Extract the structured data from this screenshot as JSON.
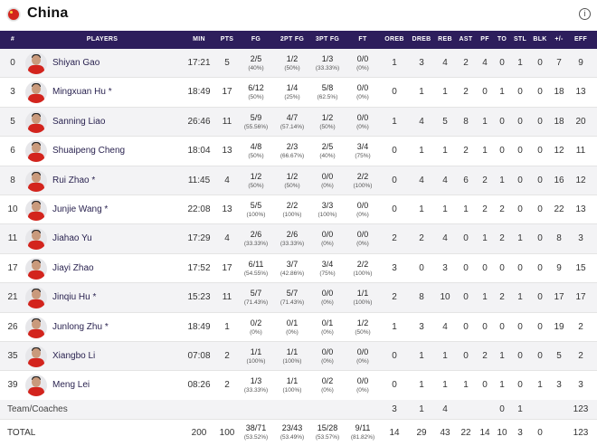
{
  "team": {
    "name": "China",
    "flag_icon": "china-flag-icon",
    "info_icon": "info-icon",
    "info_glyph": "i"
  },
  "columns": [
    "#",
    "PLAYERS",
    "MIN",
    "PTS",
    "FG",
    "2PT FG",
    "3PT FG",
    "FT",
    "OREB",
    "DREB",
    "REB",
    "AST",
    "PF",
    "TO",
    "STL",
    "BLK",
    "+/-",
    "EFF"
  ],
  "players": [
    {
      "num": "0",
      "name": "Shiyan Gao",
      "min": "17:21",
      "pts": "5",
      "fg": "2/5",
      "fg_p": "(40%)",
      "tp": "1/2",
      "tp_p": "(50%)",
      "thr": "1/3",
      "thr_p": "(33.33%)",
      "ft": "0/0",
      "ft_p": "(0%)",
      "oreb": "1",
      "dreb": "3",
      "reb": "4",
      "ast": "2",
      "pf": "4",
      "to": "0",
      "stl": "1",
      "blk": "0",
      "pm": "7",
      "eff": "9"
    },
    {
      "num": "3",
      "name": "Mingxuan Hu *",
      "min": "18:49",
      "pts": "17",
      "fg": "6/12",
      "fg_p": "(50%)",
      "tp": "1/4",
      "tp_p": "(25%)",
      "thr": "5/8",
      "thr_p": "(62.5%)",
      "ft": "0/0",
      "ft_p": "(0%)",
      "oreb": "0",
      "dreb": "1",
      "reb": "1",
      "ast": "2",
      "pf": "0",
      "to": "1",
      "stl": "0",
      "blk": "0",
      "pm": "18",
      "eff": "13"
    },
    {
      "num": "5",
      "name": "Sanning Liao",
      "min": "26:46",
      "pts": "11",
      "fg": "5/9",
      "fg_p": "(55.56%)",
      "tp": "4/7",
      "tp_p": "(57.14%)",
      "thr": "1/2",
      "thr_p": "(50%)",
      "ft": "0/0",
      "ft_p": "(0%)",
      "oreb": "1",
      "dreb": "4",
      "reb": "5",
      "ast": "8",
      "pf": "1",
      "to": "0",
      "stl": "0",
      "blk": "0",
      "pm": "18",
      "eff": "20"
    },
    {
      "num": "6",
      "name": "Shuaipeng Cheng",
      "min": "18:04",
      "pts": "13",
      "fg": "4/8",
      "fg_p": "(50%)",
      "tp": "2/3",
      "tp_p": "(66.67%)",
      "thr": "2/5",
      "thr_p": "(40%)",
      "ft": "3/4",
      "ft_p": "(75%)",
      "oreb": "0",
      "dreb": "1",
      "reb": "1",
      "ast": "2",
      "pf": "1",
      "to": "0",
      "stl": "0",
      "blk": "0",
      "pm": "12",
      "eff": "11"
    },
    {
      "num": "8",
      "name": "Rui Zhao *",
      "min": "11:45",
      "pts": "4",
      "fg": "1/2",
      "fg_p": "(50%)",
      "tp": "1/2",
      "tp_p": "(50%)",
      "thr": "0/0",
      "thr_p": "(0%)",
      "ft": "2/2",
      "ft_p": "(100%)",
      "oreb": "0",
      "dreb": "4",
      "reb": "4",
      "ast": "6",
      "pf": "2",
      "to": "1",
      "stl": "0",
      "blk": "0",
      "pm": "16",
      "eff": "12"
    },
    {
      "num": "10",
      "name": "Junjie Wang *",
      "min": "22:08",
      "pts": "13",
      "fg": "5/5",
      "fg_p": "(100%)",
      "tp": "2/2",
      "tp_p": "(100%)",
      "thr": "3/3",
      "thr_p": "(100%)",
      "ft": "0/0",
      "ft_p": "(0%)",
      "oreb": "0",
      "dreb": "1",
      "reb": "1",
      "ast": "1",
      "pf": "2",
      "to": "2",
      "stl": "0",
      "blk": "0",
      "pm": "22",
      "eff": "13"
    },
    {
      "num": "11",
      "name": "Jiahao Yu",
      "min": "17:29",
      "pts": "4",
      "fg": "2/6",
      "fg_p": "(33.33%)",
      "tp": "2/6",
      "tp_p": "(33.33%)",
      "thr": "0/0",
      "thr_p": "(0%)",
      "ft": "0/0",
      "ft_p": "(0%)",
      "oreb": "2",
      "dreb": "2",
      "reb": "4",
      "ast": "0",
      "pf": "1",
      "to": "2",
      "stl": "1",
      "blk": "0",
      "pm": "8",
      "eff": "3"
    },
    {
      "num": "17",
      "name": "Jiayi Zhao",
      "min": "17:52",
      "pts": "17",
      "fg": "6/11",
      "fg_p": "(54.55%)",
      "tp": "3/7",
      "tp_p": "(42.86%)",
      "thr": "3/4",
      "thr_p": "(75%)",
      "ft": "2/2",
      "ft_p": "(100%)",
      "oreb": "3",
      "dreb": "0",
      "reb": "3",
      "ast": "0",
      "pf": "0",
      "to": "0",
      "stl": "0",
      "blk": "0",
      "pm": "9",
      "eff": "15"
    },
    {
      "num": "21",
      "name": "Jinqiu Hu *",
      "min": "15:23",
      "pts": "11",
      "fg": "5/7",
      "fg_p": "(71.43%)",
      "tp": "5/7",
      "tp_p": "(71.43%)",
      "thr": "0/0",
      "thr_p": "(0%)",
      "ft": "1/1",
      "ft_p": "(100%)",
      "oreb": "2",
      "dreb": "8",
      "reb": "10",
      "ast": "0",
      "pf": "1",
      "to": "2",
      "stl": "1",
      "blk": "0",
      "pm": "17",
      "eff": "17"
    },
    {
      "num": "26",
      "name": "Junlong Zhu *",
      "min": "18:49",
      "pts": "1",
      "fg": "0/2",
      "fg_p": "(0%)",
      "tp": "0/1",
      "tp_p": "(0%)",
      "thr": "0/1",
      "thr_p": "(0%)",
      "ft": "1/2",
      "ft_p": "(50%)",
      "oreb": "1",
      "dreb": "3",
      "reb": "4",
      "ast": "0",
      "pf": "0",
      "to": "0",
      "stl": "0",
      "blk": "0",
      "pm": "19",
      "eff": "2"
    },
    {
      "num": "35",
      "name": "Xiangbo Li",
      "min": "07:08",
      "pts": "2",
      "fg": "1/1",
      "fg_p": "(100%)",
      "tp": "1/1",
      "tp_p": "(100%)",
      "thr": "0/0",
      "thr_p": "(0%)",
      "ft": "0/0",
      "ft_p": "(0%)",
      "oreb": "0",
      "dreb": "1",
      "reb": "1",
      "ast": "0",
      "pf": "2",
      "to": "1",
      "stl": "0",
      "blk": "0",
      "pm": "5",
      "eff": "2"
    },
    {
      "num": "39",
      "name": "Meng Lei",
      "min": "08:26",
      "pts": "2",
      "fg": "1/3",
      "fg_p": "(33.33%)",
      "tp": "1/1",
      "tp_p": "(100%)",
      "thr": "0/2",
      "thr_p": "(0%)",
      "ft": "0/0",
      "ft_p": "(0%)",
      "oreb": "0",
      "dreb": "1",
      "reb": "1",
      "ast": "1",
      "pf": "0",
      "to": "1",
      "stl": "0",
      "blk": "1",
      "pm": "3",
      "eff": "3"
    }
  ],
  "team_coaches": {
    "label": "Team/Coaches",
    "oreb": "3",
    "dreb": "1",
    "reb": "4",
    "ast": "",
    "pf": "",
    "to": "0",
    "stl": "1",
    "blk": "",
    "pm": "",
    "eff": "123"
  },
  "totals": {
    "label": "TOTAL",
    "min": "200",
    "pts": "100",
    "fg": "38/71",
    "fg_p": "(53.52%)",
    "tp": "23/43",
    "tp_p": "(53.49%)",
    "thr": "15/28",
    "thr_p": "(53.57%)",
    "ft": "9/11",
    "ft_p": "(81.82%)",
    "oreb": "14",
    "dreb": "29",
    "reb": "43",
    "ast": "22",
    "pf": "14",
    "to": "10",
    "stl": "3",
    "blk": "0",
    "pm": "",
    "eff": "123"
  }
}
